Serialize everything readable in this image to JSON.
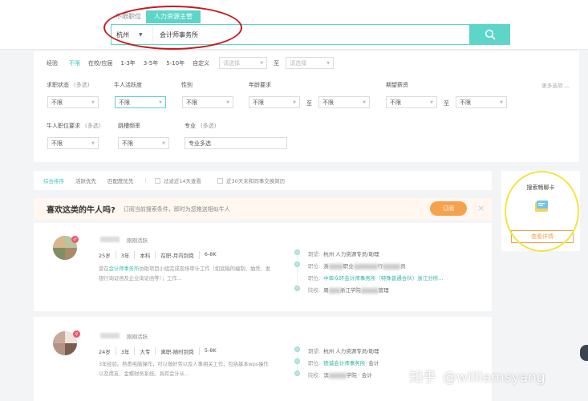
{
  "search": {
    "tabs": [
      "不限职位",
      "人力资源主管"
    ],
    "city": "杭州",
    "keyword": "会计师事务所"
  },
  "filters": {
    "experience": {
      "label": "经验",
      "options": [
        "不限",
        "在校/应届",
        "1-3年",
        "3-5年",
        "5-10年",
        "自定义"
      ],
      "from_placeholder": "请选择",
      "to_label": "至",
      "to_placeholder": "请选择"
    },
    "job_status": {
      "label": "求职状态",
      "hint": "(多选)",
      "value": "不限"
    },
    "activity": {
      "label": "牛人活跃度",
      "value": "不限"
    },
    "gender": {
      "label": "性别",
      "value": "不限"
    },
    "age": {
      "label": "年龄要求",
      "from": "不限",
      "to_label": "至",
      "to": "不限"
    },
    "salary": {
      "label": "期望薪资",
      "from": "不限",
      "to_label": "至",
      "to": "不限"
    },
    "more_label": "更多选项 ︿",
    "position_req": {
      "label": "牛人职位要求",
      "hint": "(多选)",
      "value": "不限"
    },
    "job_hopping": {
      "label": "跳槽频率",
      "value": "不限"
    },
    "major": {
      "label": "专业",
      "hint": "(多选)",
      "value": "专业多选"
    }
  },
  "sort": {
    "options": [
      "综合排序",
      "活跃优先",
      "匹配度优先"
    ],
    "separator": "|",
    "checkbox1": "过滤近14天查看",
    "checkbox2": "近30天未和同事交换简历"
  },
  "banner": {
    "title": "喜欢这类的牛人吗?",
    "subtitle": "订阅当前搜索条件，即时为您推送相似牛人",
    "subscribe_label": "订阅",
    "close": "×"
  },
  "candidates": [
    {
      "active": "刚刚活跃",
      "info": [
        "25岁",
        "3年",
        "本科",
        "在职-月内到岗",
        "6-8K"
      ],
      "desc_prefix": "曾在",
      "desc_highlight": "会计师事务所",
      "desc_rest": "协助项目小组完成现场审计工作（如底稿的编制、抽凭、发银行询证函及企业询证函等）；工作...",
      "expect_label": "期望:",
      "expect_value": "杭州  人力资源专员/助理",
      "pos1_label": "职位:",
      "pos1_a": "浙",
      "pos1_b": "职业",
      "pos1_c": "行",
      "pos1_d": "员",
      "pos2_label": "职位:",
      "pos2_value": "中审众环会计师事务所（特殊普通合伙）浙江分所...",
      "school_label": "院校:",
      "school_a": "周",
      "school_b": "浙江学院",
      "school_c": "管理"
    },
    {
      "active": "刚刚活跃",
      "info": [
        "24岁",
        "3年",
        "大专",
        "离职-随时到岗",
        "5-8K"
      ],
      "desc": "3年经验。熟悉电脑操作，可以做好劳以及人事相关工作，包括基本wps操作以及用友、金蝶财务系统。具有会计从...",
      "expect_label": "期望:",
      "expect_value": "杭州  人力资源专员/助理",
      "pos_label": "职位:",
      "pos_highlight": "德诚会计师事务所",
      "pos_rest": "· 会计",
      "school_label": "院校:",
      "school_a": "滨",
      "school_b": "学院 · 会计"
    }
  ],
  "side_card": {
    "title": "搜索畅聊卡",
    "button": "查看详情"
  },
  "watermark": {
    "zh": "知乎",
    "handle": "@williamsyang"
  },
  "colors": {
    "accent_teal": "#5dd5c8",
    "orange": "#f5a24f",
    "annotation_red": "#c9191e",
    "annotation_yellow": "#f3e43f"
  }
}
